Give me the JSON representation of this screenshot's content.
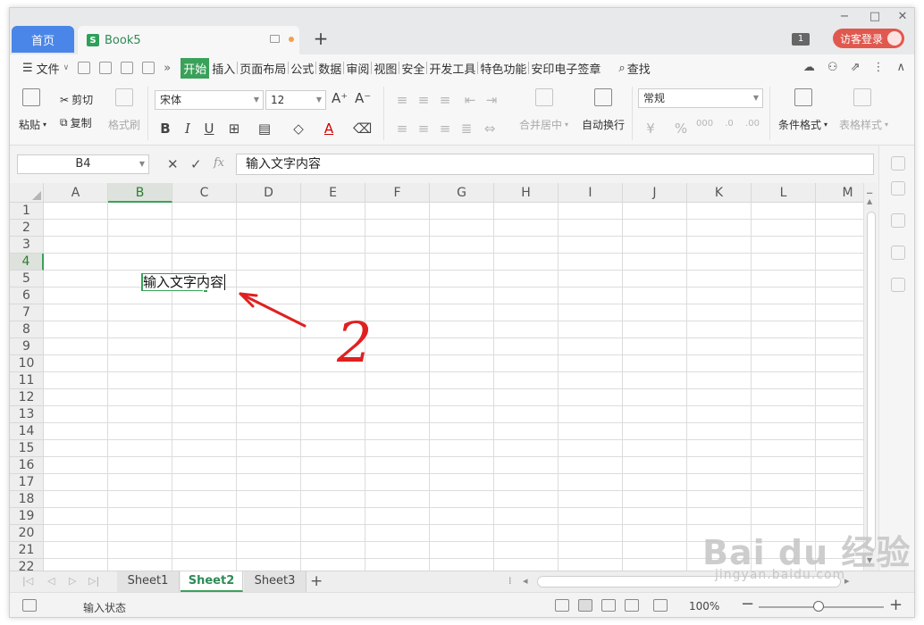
{
  "titlebar": {
    "home_tab": "首页",
    "doc_tab": "Book5",
    "doc_icon_letter": "S",
    "new_tab": "+",
    "badge": "1",
    "login_label": "访客登录",
    "minimize": "−",
    "maximize": "□",
    "close": "✕"
  },
  "menu": {
    "file_label": "文件",
    "items": [
      "开始",
      "插入",
      "页面布局",
      "公式",
      "数据",
      "审阅",
      "视图",
      "安全",
      "开发工具",
      "特色功能",
      "安印电子签章"
    ],
    "active_index": 0,
    "search_label": "查找",
    "more": "»"
  },
  "ribbon": {
    "paste": "粘贴",
    "cut": "剪切",
    "copy": "复制",
    "format_painter": "格式刷",
    "font_name": "宋体",
    "font_size": "12",
    "merge_center": "合并居中",
    "wrap_text": "自动换行",
    "number_format": "常规",
    "conditional_format": "条件格式",
    "table_style": "表格样式"
  },
  "formula_bar": {
    "name_box": "B4",
    "fx": "fx",
    "formula": "输入文字内容"
  },
  "grid": {
    "columns": [
      "A",
      "B",
      "C",
      "D",
      "E",
      "F",
      "G",
      "H",
      "I",
      "J",
      "K",
      "L",
      "M"
    ],
    "rows": [
      "1",
      "2",
      "3",
      "4",
      "5",
      "6",
      "7",
      "8",
      "9",
      "10",
      "11",
      "12",
      "13",
      "14",
      "15",
      "16",
      "17",
      "18",
      "19",
      "20",
      "21",
      "22"
    ],
    "selected_column": "B",
    "selected_row": "4",
    "active_cell_text": "输入文字内容"
  },
  "annotation": {
    "number": "2",
    "color": "#e02020"
  },
  "sheets": {
    "tabs": [
      "Sheet1",
      "Sheet2",
      "Sheet3"
    ],
    "active_index": 1,
    "add": "+"
  },
  "statusbar": {
    "status": "输入状态",
    "zoom": "100%",
    "zoom_minus": "−",
    "zoom_plus": "+"
  },
  "watermark": {
    "logo": "Bai du 经验",
    "url": "jingyan.baidu.com"
  },
  "colors": {
    "accent_green": "#3aa15a",
    "home_tab_blue": "#4a86e8",
    "login_red": "#e0584e"
  }
}
